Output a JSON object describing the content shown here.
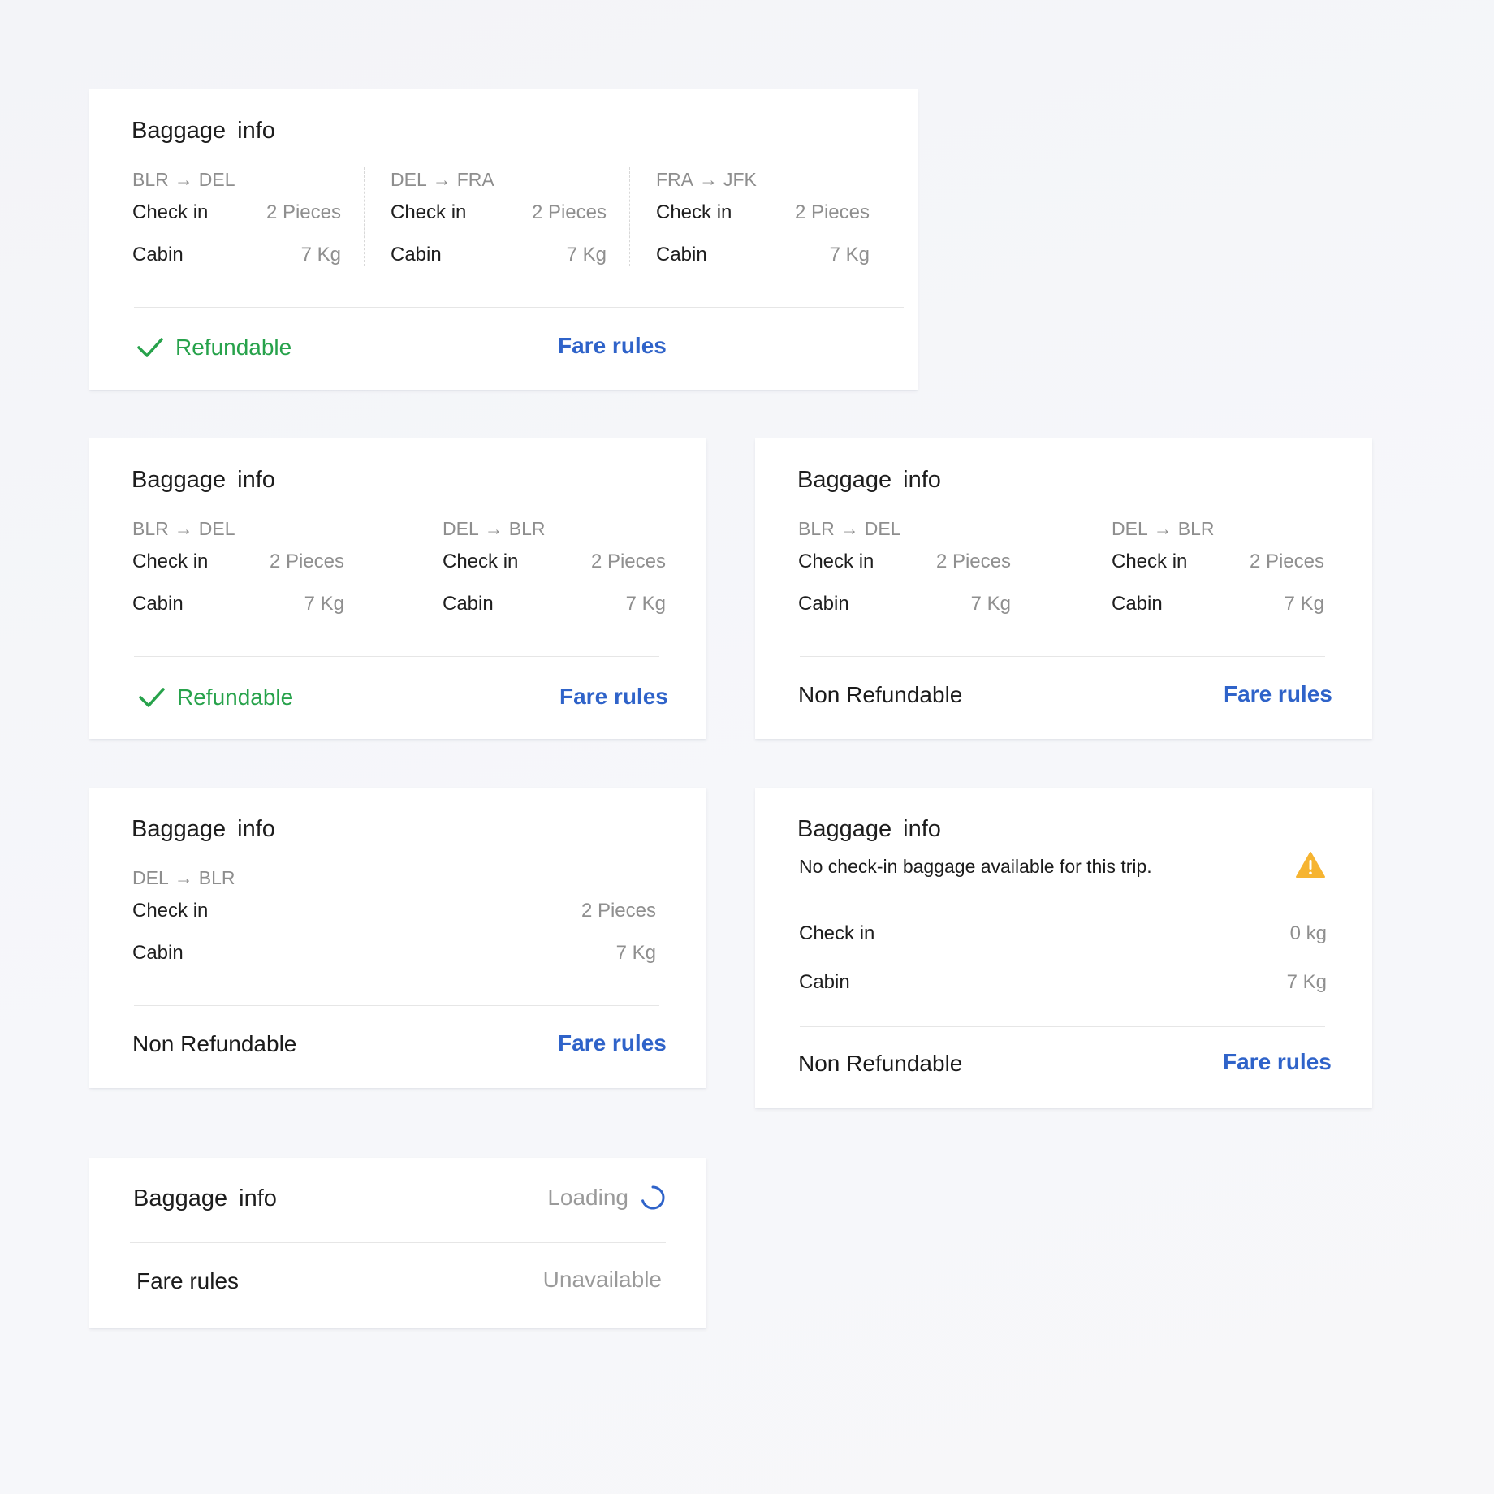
{
  "colors": {
    "background": "#f4f5f8",
    "card": "#ffffff",
    "accent_link": "#2f63c9",
    "refundable_green": "#27a24b",
    "muted_text": "#8f8f8f",
    "warning": "#f6b431"
  },
  "card1": {
    "title": "Baggage  info",
    "legs": [
      {
        "from": "BLR",
        "to": "DEL",
        "checkin_label": "Check in",
        "checkin_value": "2 Pieces",
        "cabin_label": "Cabin",
        "cabin_value": "7 Kg"
      },
      {
        "from": "DEL",
        "to": "FRA",
        "checkin_label": "Check in",
        "checkin_value": "2 Pieces",
        "cabin_label": "Cabin",
        "cabin_value": "7 Kg"
      },
      {
        "from": "FRA",
        "to": "JFK",
        "checkin_label": "Check in",
        "checkin_value": "2 Pieces",
        "cabin_label": "Cabin",
        "cabin_value": "7 Kg"
      }
    ],
    "status": "Refundable",
    "status_icon": "check-icon",
    "fare_rules": "Fare rules"
  },
  "card2": {
    "title": "Baggage  info",
    "legs": [
      {
        "from": "BLR",
        "to": "DEL",
        "checkin_label": "Check in",
        "checkin_value": "2 Pieces",
        "cabin_label": "Cabin",
        "cabin_value": "7 Kg"
      },
      {
        "from": "DEL",
        "to": "BLR",
        "checkin_label": "Check in",
        "checkin_value": "2 Pieces",
        "cabin_label": "Cabin",
        "cabin_value": "7 Kg"
      }
    ],
    "status": "Refundable",
    "status_icon": "check-icon",
    "fare_rules": "Fare rules"
  },
  "card3": {
    "title": "Baggage  info",
    "legs": [
      {
        "from": "BLR",
        "to": "DEL",
        "checkin_label": "Check in",
        "checkin_value": "2 Pieces",
        "cabin_label": "Cabin",
        "cabin_value": "7 Kg"
      },
      {
        "from": "DEL",
        "to": "BLR",
        "checkin_label": "Check in",
        "checkin_value": "2 Pieces",
        "cabin_label": "Cabin",
        "cabin_value": "7 Kg"
      }
    ],
    "status": "Non Refundable",
    "fare_rules": "Fare rules"
  },
  "card4": {
    "title": "Baggage  info",
    "legs": [
      {
        "from": "DEL",
        "to": "BLR",
        "checkin_label": "Check in",
        "checkin_value": "2 Pieces",
        "cabin_label": "Cabin",
        "cabin_value": "7 Kg"
      }
    ],
    "status": "Non Refundable",
    "fare_rules": "Fare rules"
  },
  "card5": {
    "title": "Baggage  info",
    "notice": "No check-in baggage available for this trip.",
    "notice_icon": "warning-icon",
    "checkin_label": "Check in",
    "checkin_value": "0 kg",
    "cabin_label": "Cabin",
    "cabin_value": "7 Kg",
    "status": "Non Refundable",
    "fare_rules": "Fare rules"
  },
  "card6": {
    "title": "Baggage  info",
    "loading_text": "Loading",
    "loading_icon": "spinner-icon",
    "fare_rules_label": "Fare rules",
    "fare_rules_status": "Unavailable"
  }
}
